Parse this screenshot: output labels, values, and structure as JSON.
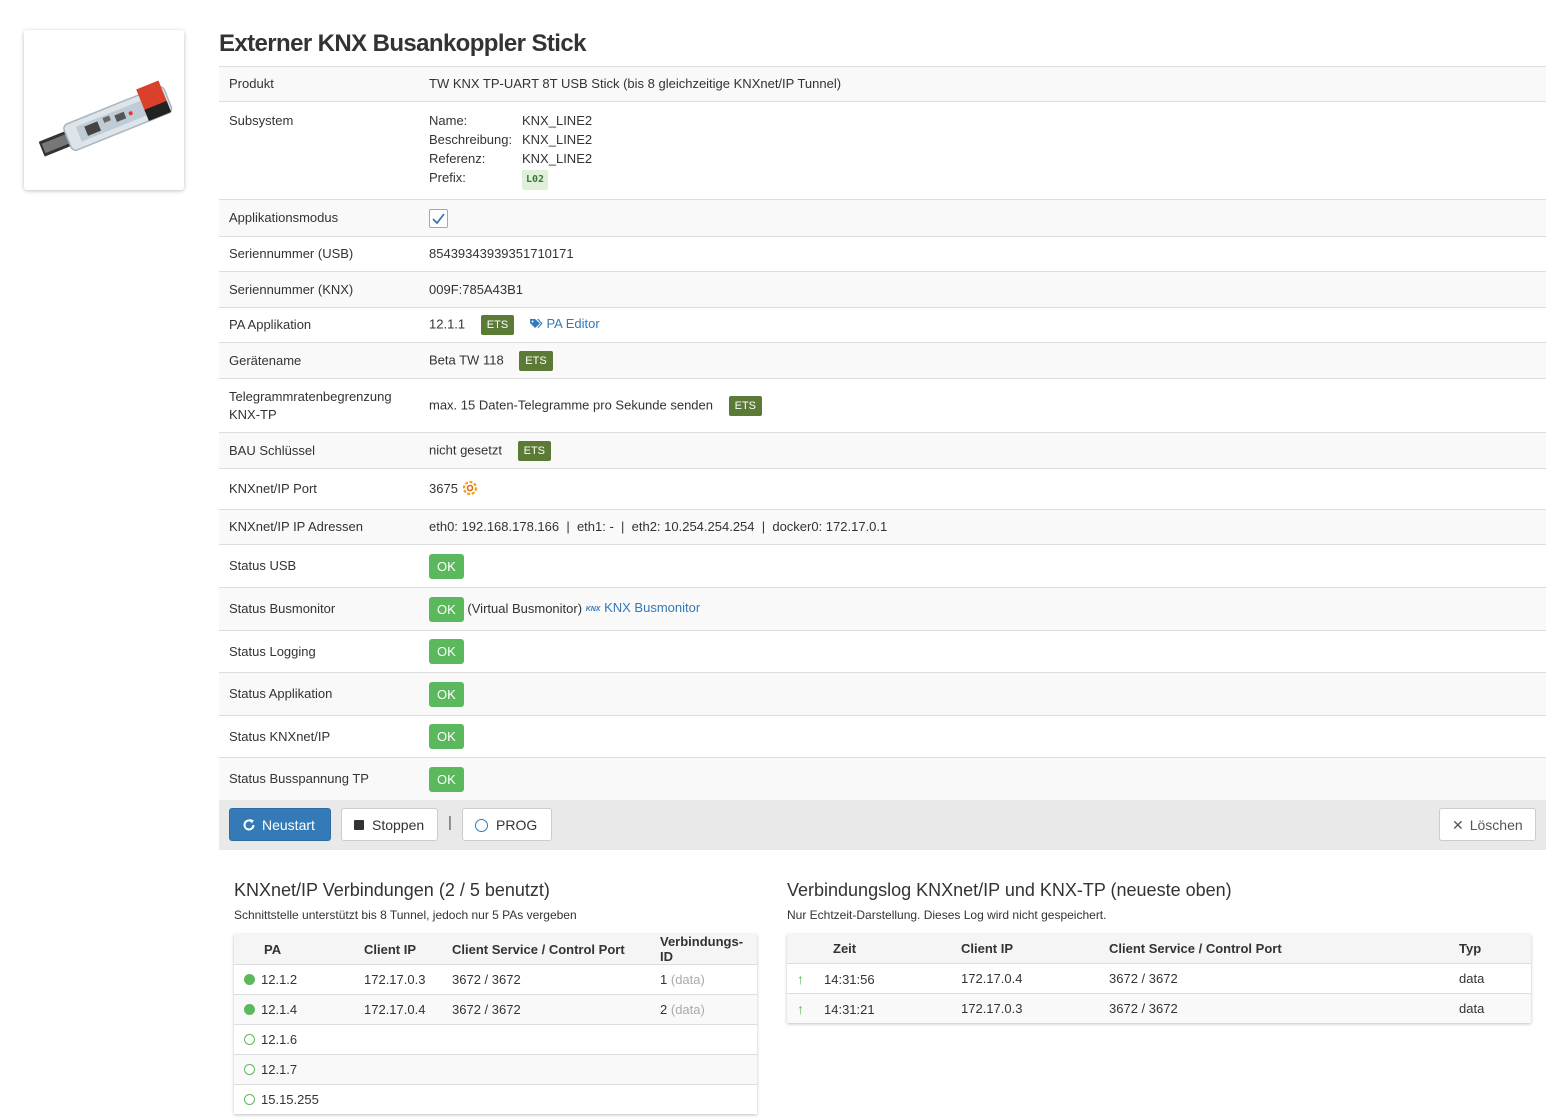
{
  "page": {
    "title": "Externer KNX Busankoppler Stick"
  },
  "props": {
    "produkt": {
      "label": "Produkt",
      "value": "TW KNX TP-UART 8T USB Stick (bis 8 gleichzeitige KNXnet/IP Tunnel)"
    },
    "subsystem": {
      "label": "Subsystem",
      "name_label": "Name:",
      "name": "KNX_LINE2",
      "desc_label": "Beschreibung:",
      "desc": "KNX_LINE2",
      "ref_label": "Referenz:",
      "ref": "KNX_LINE2",
      "prefix_label": "Prefix:",
      "prefix": "L02"
    },
    "appmode": {
      "label": "Applikationsmodus",
      "checked": true
    },
    "serial_usb": {
      "label": "Seriennummer (USB)",
      "value": "85439343939351710171"
    },
    "serial_knx": {
      "label": "Seriennummer (KNX)",
      "value": "009F:785A43B1"
    },
    "pa_app": {
      "label": "PA Applikation",
      "value": "12.1.1",
      "badge": "ETS",
      "link": "PA Editor"
    },
    "devname": {
      "label": "Gerätename",
      "value": "Beta TW 118",
      "badge": "ETS"
    },
    "ratelimit": {
      "label_1": "Telegrammratenbegrenzung",
      "label_2": "KNX-TP",
      "value": "max. 15 Daten-Telegramme pro Sekunde senden",
      "badge": "ETS"
    },
    "bau": {
      "label": "BAU Schlüssel",
      "value": "nicht gesetzt",
      "badge": "ETS"
    },
    "port": {
      "label": "KNXnet/IP Port",
      "value": "3675"
    },
    "ips": {
      "label": "KNXnet/IP IP Adressen",
      "value": "eth0: 192.168.178.166  |  eth1: -  |  eth2: 10.254.254.254  |  docker0: 172.17.0.1"
    },
    "status_usb": {
      "label": "Status USB",
      "value": "OK"
    },
    "status_busmon": {
      "label": "Status Busmonitor",
      "value": "OK",
      "note": "(Virtual Busmonitor)",
      "logo": "KNX",
      "link": "KNX Busmonitor"
    },
    "status_logging": {
      "label": "Status Logging",
      "value": "OK"
    },
    "status_app": {
      "label": "Status Applikation",
      "value": "OK"
    },
    "status_knxip": {
      "label": "Status KNXnet/IP",
      "value": "OK"
    },
    "status_bus": {
      "label": "Status Busspannung TP",
      "value": "OK"
    }
  },
  "toolbar": {
    "restart": "Neustart",
    "stop": "Stoppen",
    "sep": "|",
    "prog": "PROG",
    "delete": "Löschen"
  },
  "connections": {
    "title": "KNXnet/IP Verbindungen (2 / 5 benutzt)",
    "subtitle": "Schnittstelle unterstützt bis 8 Tunnel, jedoch nur 5 PAs vergeben",
    "headers": [
      "PA",
      "Client IP",
      "Client Service / Control Port",
      "Verbindungs-ID"
    ],
    "rows": [
      {
        "pa": "12.1.2",
        "active": true,
        "ip": "172.17.0.3",
        "port": "3672 / 3672",
        "id": "1",
        "type": "(data)"
      },
      {
        "pa": "12.1.4",
        "active": true,
        "ip": "172.17.0.4",
        "port": "3672 / 3672",
        "id": "2",
        "type": "(data)"
      },
      {
        "pa": "12.1.6",
        "active": false,
        "ip": "",
        "port": "",
        "id": "",
        "type": ""
      },
      {
        "pa": "12.1.7",
        "active": false,
        "ip": "",
        "port": "",
        "id": "",
        "type": ""
      },
      {
        "pa": "15.15.255",
        "active": false,
        "ip": "",
        "port": "",
        "id": "",
        "type": ""
      }
    ]
  },
  "log": {
    "title": "Verbindungslog KNXnet/IP und KNX-TP (neueste oben)",
    "subtitle": "Nur Echtzeit-Darstellung. Dieses Log wird nicht gespeichert.",
    "headers": [
      "Zeit",
      "Client IP",
      "Client Service / Control Port",
      "Typ"
    ],
    "rows": [
      {
        "time": "14:31:56",
        "ip": "172.17.0.4",
        "port": "3672 / 3672",
        "type": "data"
      },
      {
        "time": "14:31:21",
        "ip": "172.17.0.3",
        "port": "3672 / 3672",
        "type": "data"
      }
    ]
  }
}
